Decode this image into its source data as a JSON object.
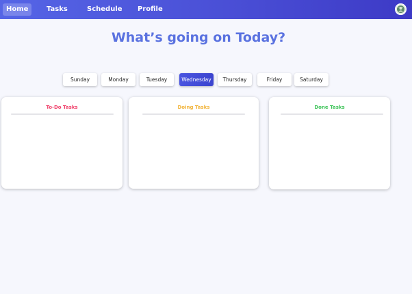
{
  "nav": {
    "items": [
      {
        "label": "Home",
        "active": true
      },
      {
        "label": "Tasks",
        "active": false
      },
      {
        "label": "Schedule",
        "active": false
      },
      {
        "label": "Profile",
        "active": false
      }
    ],
    "avatar_icon": "user-avatar-icon",
    "accent_color": "#4a4fd6"
  },
  "main": {
    "title": "What’s going on Today?"
  },
  "days": {
    "items": [
      "Sunday",
      "Monday",
      "Tuesday",
      "Wednesday",
      "Thursday",
      "Friday",
      "Saturday"
    ],
    "selected": "Wednesday"
  },
  "boards": [
    {
      "title": "To-Do Tasks",
      "color": "#f0406a"
    },
    {
      "title": "Doing Tasks",
      "color": "#f2b43a"
    },
    {
      "title": "Done Tasks",
      "color": "#3fc45a"
    }
  ]
}
